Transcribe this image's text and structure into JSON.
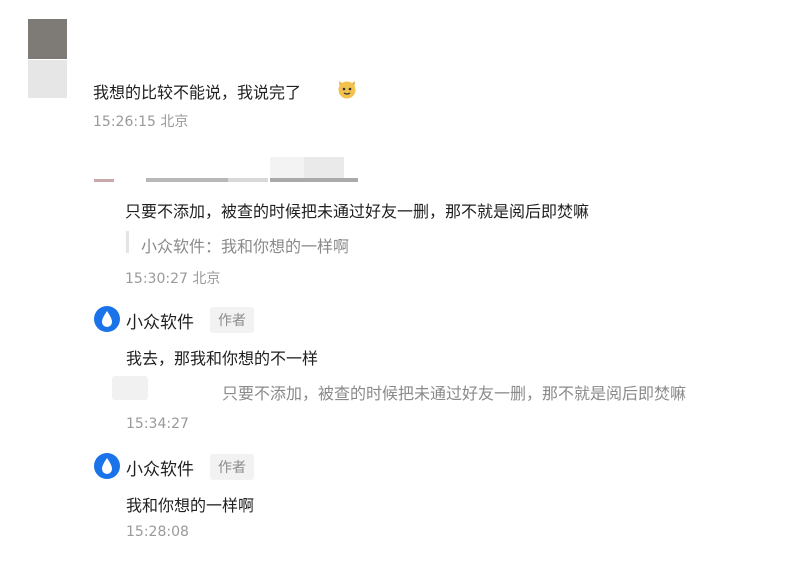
{
  "comments": [
    {
      "text": "我想的比较不能说，我说完了",
      "emoji_icon": "cat-face-emoji",
      "time": "15:26:15 北京"
    },
    {
      "text": "只要不添加，被查的时候把未通过好友一删，那不就是阅后即焚嘛",
      "quote": "小众软件：我和你想的一样啊",
      "time": "15:30:27 北京"
    },
    {
      "name": "小众软件",
      "badge": "作者",
      "avatar_icon": "water-drop-logo-icon",
      "text": "我去，那我和你想的不一样",
      "quote": "只要不添加，被查的时候把未通过好友一删，那不就是阅后即焚嘛",
      "time": "15:34:27"
    },
    {
      "name": "小众软件",
      "badge": "作者",
      "avatar_icon": "water-drop-logo-icon",
      "text": "我和你想的一样啊",
      "time": "15:28:08"
    }
  ],
  "colors": {
    "accent": "#1a73e8",
    "time": "#9a9a9a",
    "badge_bg": "#f2f2f2"
  }
}
